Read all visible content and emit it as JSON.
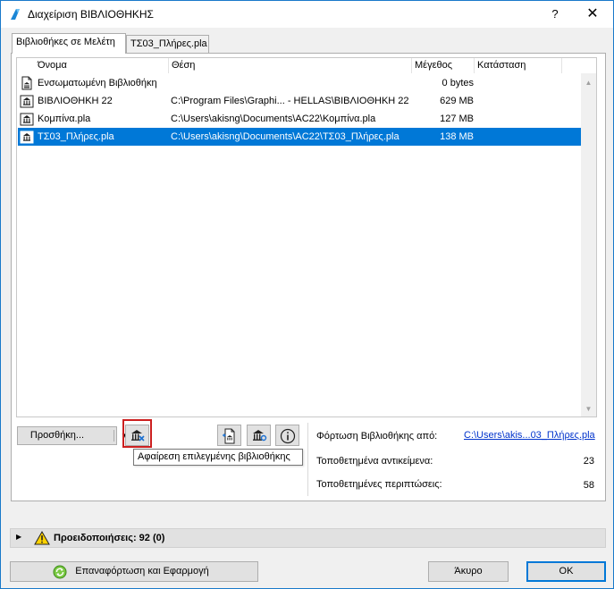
{
  "window": {
    "title": "Διαχείριση ΒΙΒΛΙΟΘΗΚΗΣ",
    "help_label": "?",
    "close_label": "✕"
  },
  "tabs": [
    {
      "label": "Βιβλιοθήκες σε Μελέτη",
      "active": true
    },
    {
      "label": "ΤΣ03_Πλήρες.pla",
      "active": false
    }
  ],
  "library_list": {
    "columns": [
      "Όνομα",
      "Θέση",
      "Μέγεθος",
      "Κατάσταση"
    ],
    "rows": [
      {
        "icon": "document-library-icon",
        "name": "Ενσωματωμένη Βιβλιοθήκη",
        "location": "",
        "size": "0 bytes",
        "status": "",
        "selected": false
      },
      {
        "icon": "library-icon",
        "name": "ΒΙΒΛΙΟΘΗΚΗ 22",
        "location": "C:\\Program Files\\Graphi... - HELLAS\\ΒΙΒΛΙΟΘΗΚΗ 22",
        "size": "629 MB",
        "status": "",
        "selected": false
      },
      {
        "icon": "library-icon",
        "name": "Κομπίνα.pla",
        "location": "C:\\Users\\akisng\\Documents\\AC22\\Κομπίνα.pla",
        "size": "127 MB",
        "status": "",
        "selected": false
      },
      {
        "icon": "library-icon",
        "name": "ΤΣ03_Πλήρες.pla",
        "location": "C:\\Users\\akisng\\Documents\\AC22\\ΤΣ03_Πλήρες.pla",
        "size": "138 MB",
        "status": "",
        "selected": true
      }
    ]
  },
  "toolbar": {
    "add_label": "Προσθήκη...",
    "remove_tooltip": "Αφαίρεση επιλεγμένης βιβλιοθήκης"
  },
  "info": {
    "load_from_label": "Φόρτωση Βιβλιοθήκης από:",
    "load_from_value": "C:\\Users\\akis...03_Πλήρες.pla",
    "placed_objects_label": "Τοποθετημένα αντικείμενα:",
    "placed_objects_value": "23",
    "placed_instances_label": "Τοποθετημένες περιπτώσεις:",
    "placed_instances_value": "58"
  },
  "warnings": {
    "label": "Προειδοποιήσεις: 92 (0)"
  },
  "footer": {
    "reload_label": "Επαναφόρτωση και Εφαρμογή",
    "cancel_label": "Άκυρο",
    "ok_label": "OK"
  },
  "colors": {
    "selection": "#0078d7",
    "highlight_box": "#cc1f1f",
    "link": "#0033cc"
  }
}
